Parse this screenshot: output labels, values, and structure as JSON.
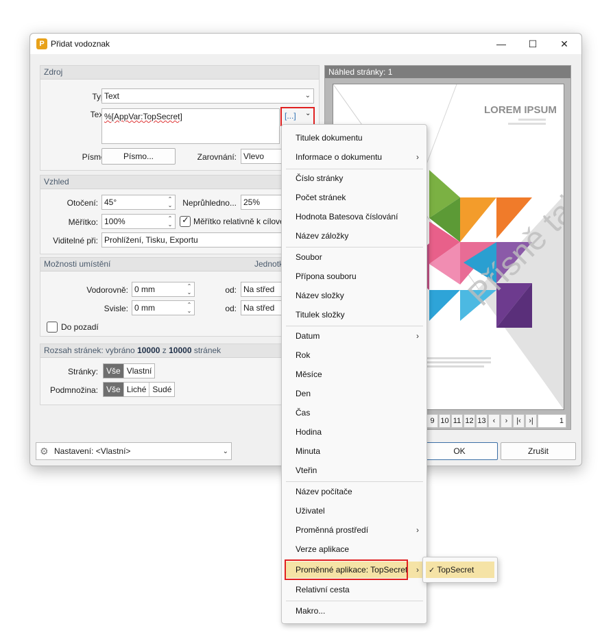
{
  "window": {
    "title": "Přidat vodoznak"
  },
  "source": {
    "header": "Zdroj",
    "type_label": "Typ:",
    "type_value": "Text",
    "text_label": "Text:",
    "text_value": "%[AppVar:TopSecret]",
    "macro_button": "[...]",
    "font_label": "Písmo:",
    "font_button": "Písmo...",
    "align_label": "Zarovnání:",
    "align_value": "Vlevo"
  },
  "appearance": {
    "header": "Vzhled",
    "rotation_label": "Otočení:",
    "rotation_value": "45°",
    "opacity_label": "Neprůhledno...",
    "opacity_value": "25%",
    "scale_label": "Měřítko:",
    "scale_value": "100%",
    "scale_relative_label": "Měřítko relativně k cílové",
    "visible_label": "Viditelné při:",
    "visible_value": "Prohlížení, Tisku, Exportu"
  },
  "placement": {
    "header": "Možnosti umístění",
    "units_label": "Jednotk",
    "horizontal_label": "Vodorovně:",
    "horizontal_value": "0 mm",
    "vertical_label": "Svisle:",
    "vertical_value": "0 mm",
    "from_label": "od:",
    "from_h_value": "Na střed",
    "from_v_value": "Na střed",
    "background_label": "Do pozadí"
  },
  "range": {
    "header_prefix": "Rozsah stránek: vybráno ",
    "selected": "10000",
    "header_mid": " z ",
    "total": "10000",
    "header_suffix": " stránek",
    "pages_label": "Stránky:",
    "pages_options": [
      "Vše",
      "Vlastní"
    ],
    "subset_label": "Podmnožina:",
    "subset_options": [
      "Vše",
      "Liché",
      "Sudé"
    ]
  },
  "preview": {
    "header": "Náhled stránky: 1",
    "lorem_title": "LOREM IPSUM",
    "watermark": "Přísně tajné",
    "pager_pages": [
      "9",
      "10",
      "11",
      "12",
      "13"
    ],
    "current_page": "1"
  },
  "footer": {
    "settings_label": "Nastavení:",
    "settings_value": "<Vlastní>",
    "ok": "OK",
    "cancel": "Zrušit"
  },
  "menu": {
    "items": [
      "Titulek dokumentu",
      "Informace o dokumentu",
      "Číslo stránky",
      "Počet stránek",
      "Hodnota Batesova číslování",
      "Název záložky",
      "Soubor",
      "Přípona souboru",
      "Název složky",
      "Titulek složky",
      "Datum",
      "Rok",
      "Měsíce",
      "Den",
      "Čas",
      "Hodina",
      "Minuta",
      "Vteřin",
      "Název počítače",
      "Uživatel",
      "Proměnná prostředí",
      "Verze aplikace",
      "Proměnné aplikace: TopSecret",
      "Relativní cesta",
      "Makro..."
    ],
    "submenu_item": "TopSecret"
  },
  "colors": {
    "highlight": "#f5e3a6",
    "callout": "#e02020",
    "accent": "#3a6ea5"
  }
}
